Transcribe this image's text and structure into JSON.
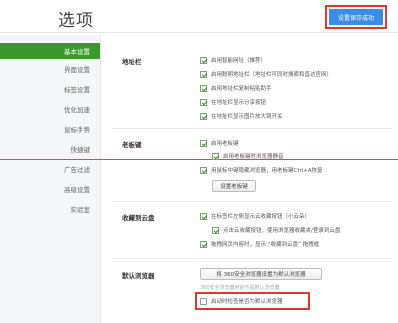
{
  "header": {
    "title": "选项",
    "toast": "设置保存成功"
  },
  "sidebar": {
    "items": [
      {
        "label": "基本设置"
      },
      {
        "label": "界面设置"
      },
      {
        "label": "标签设置"
      },
      {
        "label": "优化加速"
      },
      {
        "label": "鼠标手势"
      },
      {
        "label": "快捷键"
      },
      {
        "label": "广告过滤"
      },
      {
        "label": "高级设置"
      },
      {
        "label": "实验室"
      }
    ]
  },
  "address_bar": {
    "label": "地址栏",
    "options": [
      {
        "label": "启用智能网址（推荐）",
        "checked": true
      },
      {
        "label": "启用聪明地址栏（地址栏可同时搜索和直达官网）",
        "checked": true
      },
      {
        "label": "启用地址栏复制粘贴助手",
        "checked": true
      },
      {
        "label": "在地址栏显示分享按钮",
        "checked": true
      },
      {
        "label": "在地址栏显示图片放大镜开关",
        "checked": true
      }
    ]
  },
  "boss_key": {
    "label": "老板键",
    "options": [
      {
        "label": "启用老板键",
        "checked": true
      },
      {
        "label": "启用老板键时浏览器静音",
        "checked": true
      },
      {
        "label": "用鼠标中键隐藏浏览器，用老板键Ctrl+A恢复",
        "checked": true
      }
    ],
    "button": "设置老板键"
  },
  "favorites": {
    "label": "收藏到云盘",
    "options": [
      {
        "label": "在标签栏左侧显示云收藏按钮（小云朵）",
        "checked": true
      },
      {
        "label": "点击云收藏按钮，使用浏览器收藏夹/登录到云盘",
        "checked": true
      },
      {
        "label": "拖拽网页内容时，显示 “收藏到云盘” 拖拽框",
        "checked": true
      }
    ]
  },
  "default_browser": {
    "label": "默认浏览器",
    "button": "将 360安全浏览器设置为默认浏览器",
    "note": "360安全浏览器目前不是默认浏览器",
    "check_option": {
      "label": "启动时检查是否为默认浏览器",
      "checked": false
    }
  },
  "colors": {
    "accent_green": "#3a9a2e",
    "highlight_red": "#e0362b",
    "toast_blue": "#3a8de6"
  }
}
